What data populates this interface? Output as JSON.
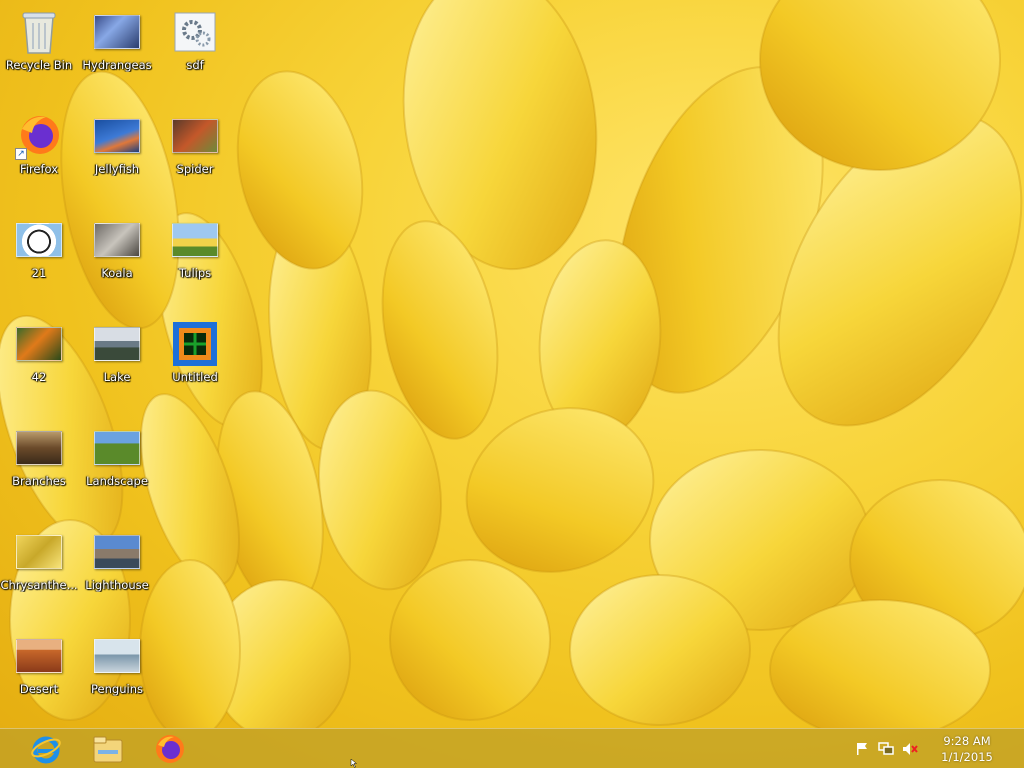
{
  "desktop": {
    "icons": [
      {
        "label": "Recycle Bin",
        "icon": "recycle-bin-icon"
      },
      {
        "label": "Hydrangeas",
        "icon": "image-file-icon"
      },
      {
        "label": "sdf",
        "icon": "settings-file-icon"
      },
      {
        "label": "Firefox",
        "icon": "firefox-icon"
      },
      {
        "label": "Jellyfish",
        "icon": "image-file-icon"
      },
      {
        "label": "Spider",
        "icon": "image-file-icon"
      },
      {
        "label": "21",
        "icon": "image-file-icon"
      },
      {
        "label": "Koala",
        "icon": "image-file-icon"
      },
      {
        "label": "Tulips",
        "icon": "image-file-icon"
      },
      {
        "label": "42",
        "icon": "image-file-icon"
      },
      {
        "label": "Lake",
        "icon": "image-file-icon"
      },
      {
        "label": "Untitled",
        "icon": "image-file-icon"
      },
      {
        "label": "Branches",
        "icon": "image-file-icon"
      },
      {
        "label": "Landscape",
        "icon": "image-file-icon"
      },
      {
        "label": "Chrysanthe...",
        "icon": "image-file-icon"
      },
      {
        "label": "Lighthouse",
        "icon": "image-file-icon"
      },
      {
        "label": "Desert",
        "icon": "image-file-icon"
      },
      {
        "label": "Penguins",
        "icon": "image-file-icon"
      }
    ]
  },
  "taskbar": {
    "pinned": [
      {
        "name": "Internet Explorer",
        "icon": "internet-explorer-icon"
      },
      {
        "name": "File Explorer",
        "icon": "file-explorer-icon"
      },
      {
        "name": "Firefox",
        "icon": "firefox-icon"
      }
    ],
    "tray": {
      "icons": [
        "action-center-flag-icon",
        "network-icon",
        "volume-muted-icon"
      ],
      "time": "9:28 AM",
      "date": "1/1/2015"
    }
  },
  "colors": {
    "wallpaper": "#f5cf2c",
    "taskbar": "#bea028"
  }
}
